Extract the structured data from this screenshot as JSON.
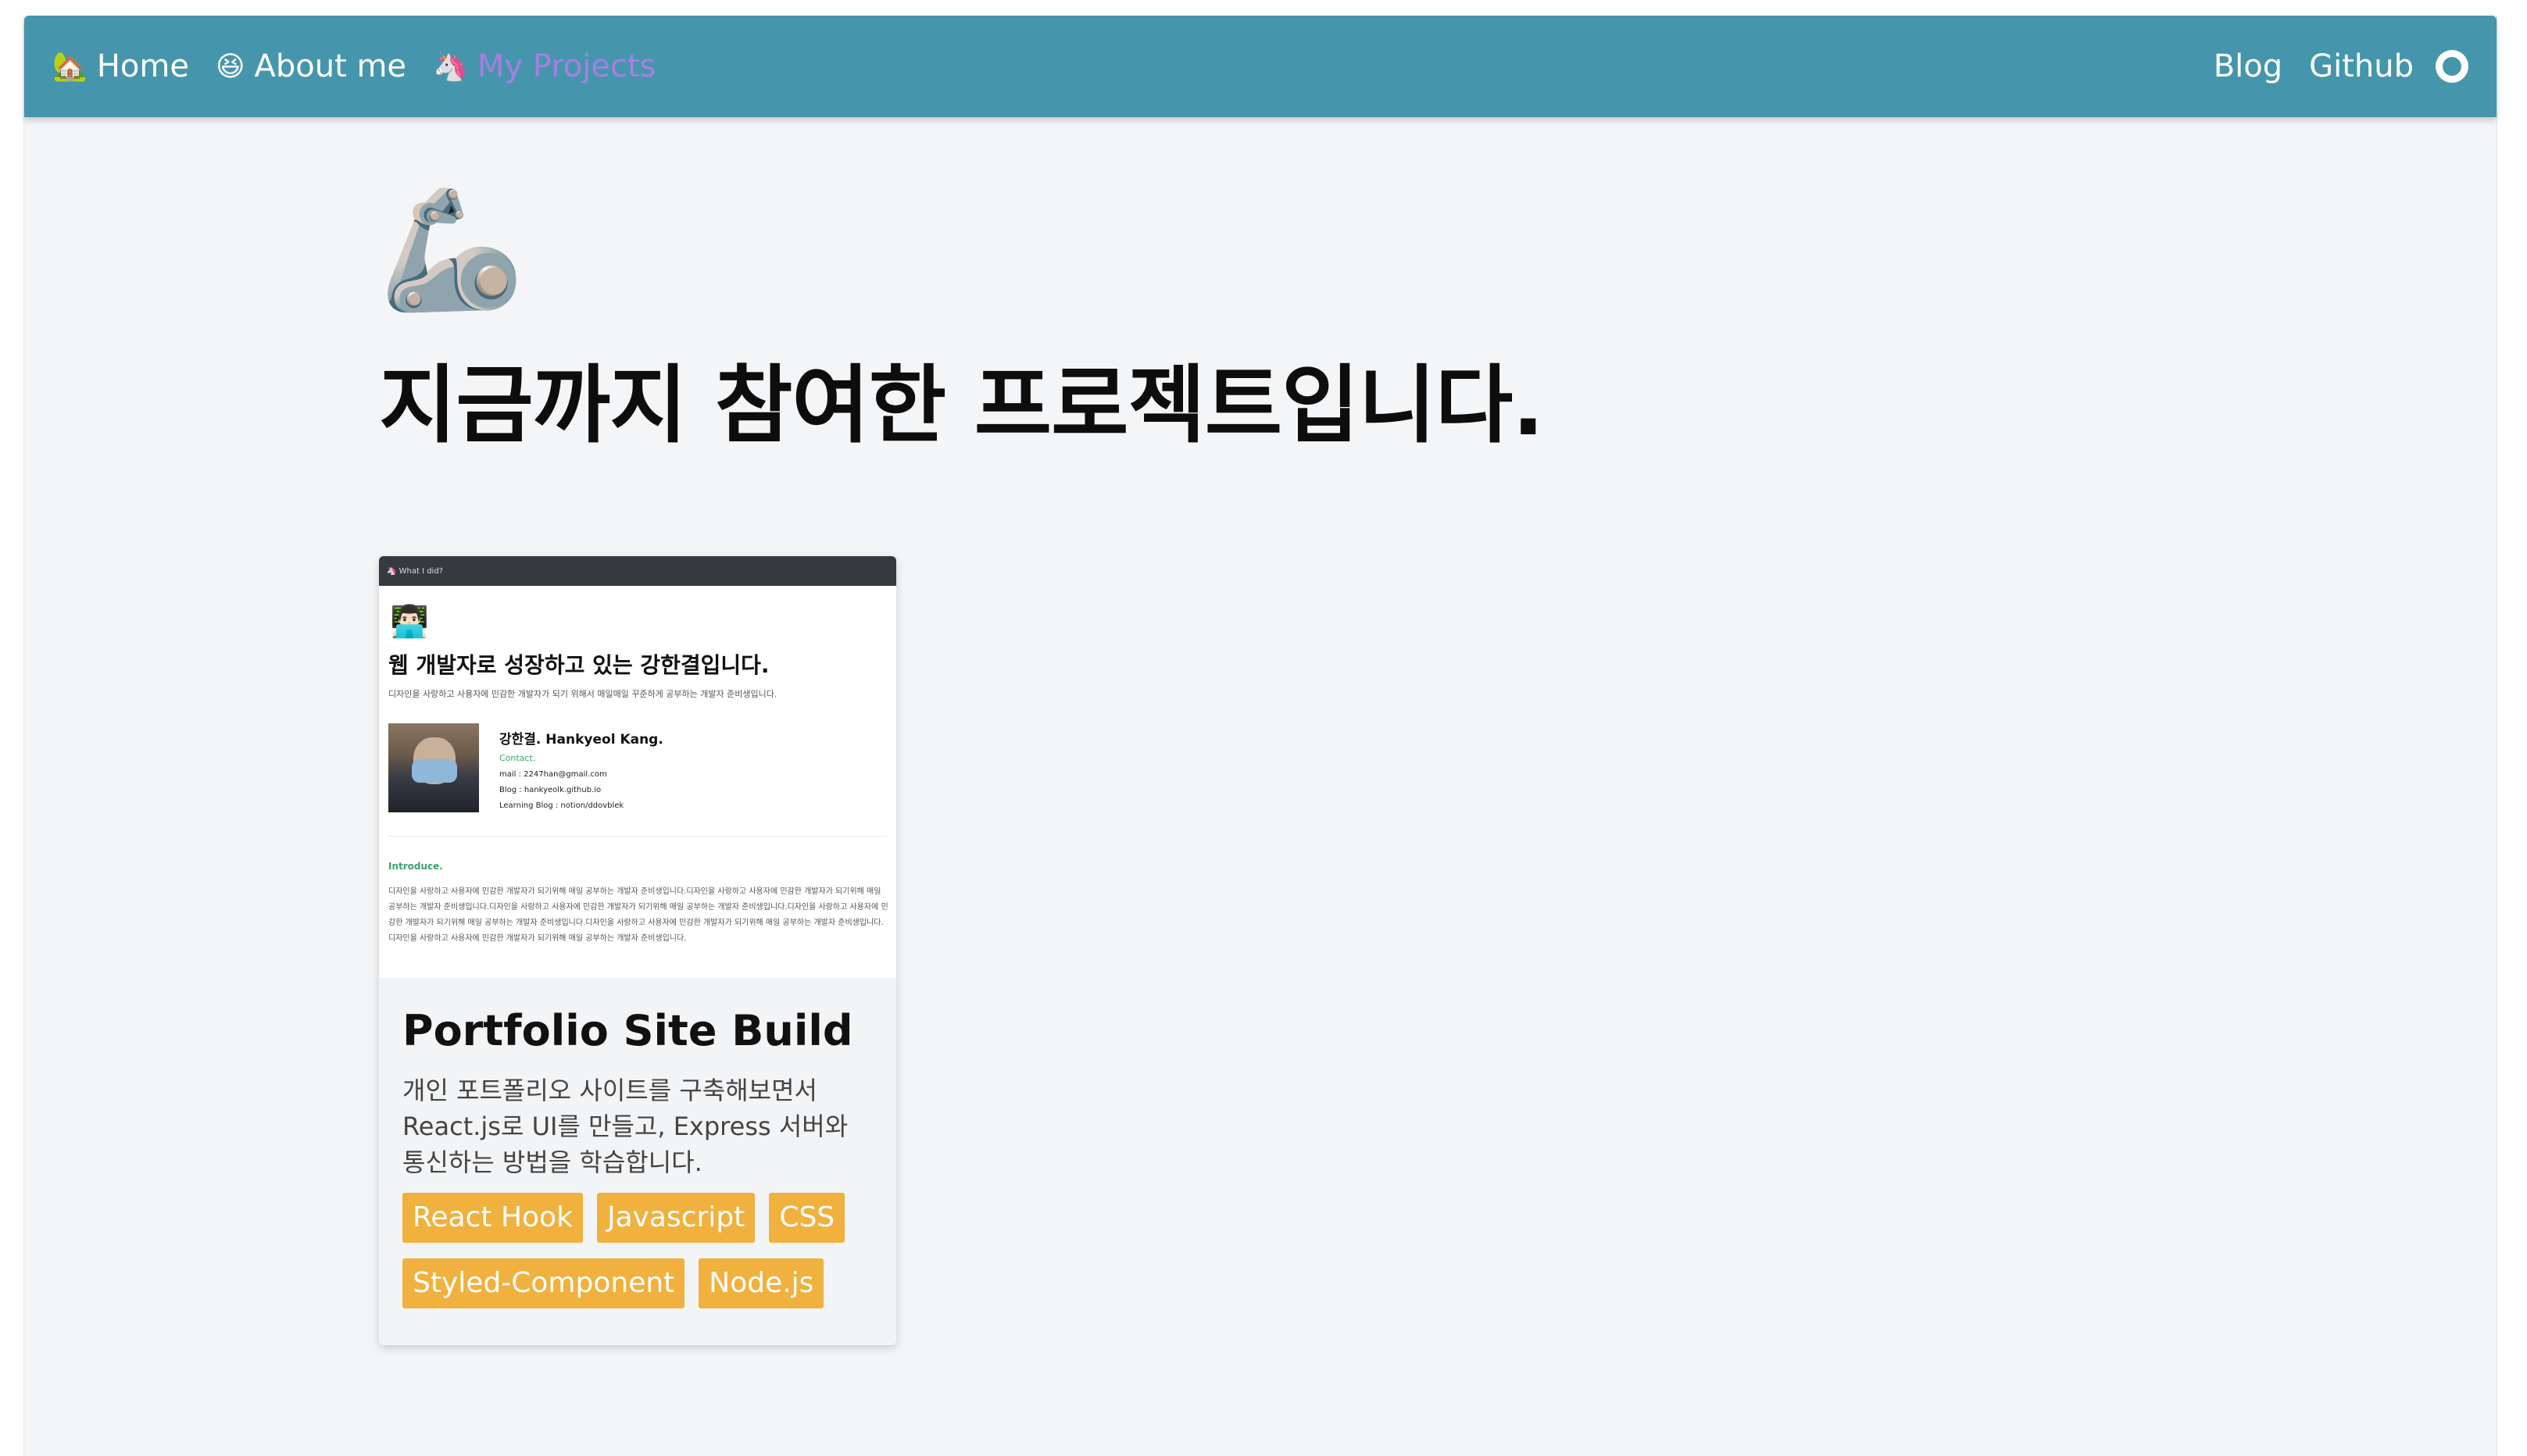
{
  "nav": {
    "home": {
      "emoji": "🏡",
      "label": "Home"
    },
    "about": {
      "emoji": "😆",
      "label": "About me"
    },
    "projects": {
      "emoji": "🦄",
      "label": "My Projects"
    },
    "blog": "Blog",
    "github": "Github",
    "github_icon": "github-icon",
    "active_color": "#a77ee0",
    "bar_color": "#4596ac"
  },
  "hero": {
    "emoji": "🦾",
    "title": "지금까지 참여한 프로젝트입니다."
  },
  "project": {
    "screenshot": {
      "bar_text": "🦄 What I did?",
      "avatar": "👨🏻‍💻",
      "title": "웹 개발자로 성장하고 있는 강한결입니다.",
      "subtitle": "디자인을 사랑하고 사용자에 민감한 개발자가 되기 위해서 매일매일 꾸준하게 공부하는 개발자 준비생입니다.",
      "name": "강한결. Hankyeol Kang.",
      "contact_label": "Contact.",
      "mail": "mail : 2247han@gmail.com",
      "blog": "Blog : hankyeolk.github.io",
      "learning_blog": "Learning Blog : notion/ddovblek",
      "intro_label": "Introduce.",
      "intro_text": "디자인을 사랑하고 사용자에 민감한 개발자가 되기위해 매일 공부하는 개발자 준비생입니다.디자인을 사랑하고 사용자에 민감한 개발자가 되기위해 매일 공부하는 개발자 준비생입니다.디자인을 사랑하고 사용자에 민감한 개발자가 되기위해 매일 공부하는 개발자 준비생입니다.디자인을 사랑하고 사용자에 민감한 개발자가 되기위해 매일 공부하는 개발자 준비생입니다.디자인을 사랑하고 사용자에 민감한 개발자가 되기위해 매일 공부하는 개발자 준비생입니다.디자인을 사랑하고 사용자에 민감한 개발자가 되기위해 매일 공부하는 개발자 준비생입니다."
    },
    "title": "Portfolio Site Build",
    "description": "개인 포트폴리오 사이트를 구축해보면서 React.js로 UI를 만들고, Express 서버와 통신하는 방법을 학습합니다.",
    "tags": [
      "React Hook",
      "Javascript",
      "CSS",
      "Styled-Component",
      "Node.js"
    ],
    "tag_color": "#f0b13e"
  }
}
